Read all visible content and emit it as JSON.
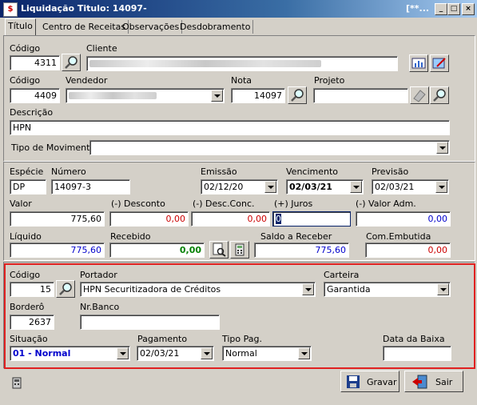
{
  "window": {
    "title": "Liquidação Titulo: 14097-",
    "title_extra": "[**..."
  },
  "tabs": [
    "Título",
    "Centro de Receitas",
    "Observações",
    "Desdobramento"
  ],
  "top": {
    "codigo_label": "Código",
    "codigo_value": "4311",
    "cliente_label": "Cliente",
    "codigo2_label": "Código",
    "codigo2_value": "4409",
    "vendedor_label": "Vendedor",
    "nota_label": "Nota",
    "nota_value": "14097",
    "projeto_label": "Projeto",
    "descricao_label": "Descrição",
    "descricao_value": "HPN",
    "tipo_mov_label": "Tipo de Movimento:"
  },
  "mid": {
    "especie_label": "Espécie",
    "especie_value": "DP",
    "numero_label": "Número",
    "numero_value": "14097-3",
    "emissao_label": "Emissão",
    "emissao_value": "02/12/20",
    "vencimento_label": "Vencimento",
    "vencimento_value": "02/03/21",
    "previsao_label": "Previsão",
    "previsao_value": "02/03/21",
    "valor_label": "Valor",
    "valor_value": "775,60",
    "desconto_label": "(-) Desconto",
    "desconto_value": "0,00",
    "desc_conc_label": "(-) Desc.Conc.",
    "desc_conc_value": "0,00",
    "juros_label": "(+) Juros",
    "juros_value": "0",
    "valor_adm_label": "(-) Valor Adm.",
    "valor_adm_value": "0,00",
    "liquido_label": "Líquido",
    "liquido_value": "775,60",
    "recebido_label": "Recebido",
    "recebido_value": "0,00",
    "saldo_label": "Saldo a Receber",
    "saldo_value": "775,60",
    "com_embutida_label": "Com.Embutida",
    "com_embutida_value": "0,00"
  },
  "bottom": {
    "codigo_label": "Código",
    "codigo_value": "15",
    "portador_label": "Portador",
    "portador_value": "HPN Securitizadora de Créditos",
    "carteira_label": "Carteira",
    "carteira_value": "Garantida",
    "bordero_label": "Borderô",
    "bordero_value": "2637",
    "nr_banco_label": "Nr.Banco",
    "nr_banco_value": "",
    "situacao_label": "Situação",
    "situacao_value": "01 - Normal",
    "pagamento_label": "Pagamento",
    "pagamento_value": "02/03/21",
    "tipo_pag_label": "Tipo Pag.",
    "tipo_pag_value": "Normal",
    "data_baixa_label": "Data da Baixa",
    "data_baixa_value": ""
  },
  "footer": {
    "gravar_label": "Gravar",
    "sair_label": "Sair"
  },
  "colors": {
    "red_value": "#cc0000",
    "blue_value": "#0000cc",
    "green_value": "#008000",
    "highlight": "#e02020"
  }
}
